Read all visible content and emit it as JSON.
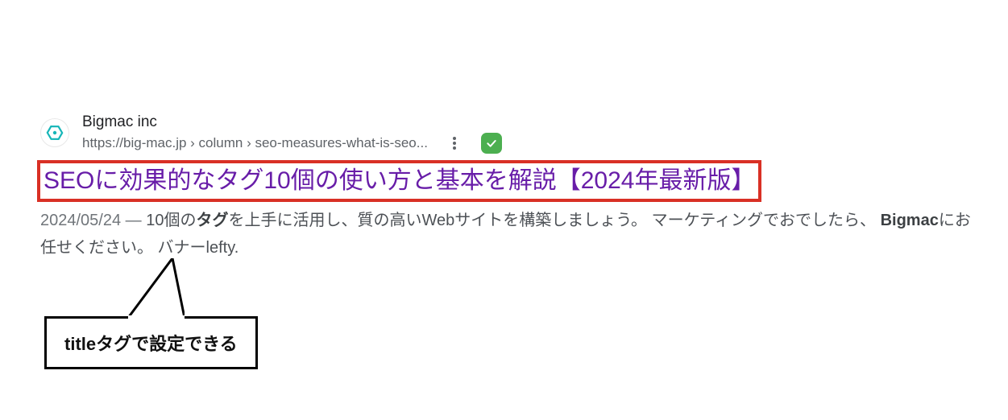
{
  "result": {
    "site_name": "Bigmac inc",
    "breadcrumbs": "https://big-mac.jp › column › seo-measures-what-is-seo...",
    "title": "SEOに効果的なタグ10個の使い方と基本を解説【2024年最新版】",
    "snippet_date": "2024/05/24",
    "snippet_sep": " — ",
    "snippet_p1": "10個の",
    "snippet_b1": "タグ",
    "snippet_p2": "を上手に活用し、質の高いWebサイトを構築しましょう。 マーケティングでお",
    "snippet_p2b": "でしたら、 ",
    "snippet_b2": "Bigmac",
    "snippet_p3": "にお任せください。 バナーlefty."
  },
  "callout": {
    "text": "titleタグで設定できる"
  },
  "icons": {
    "favicon": "bigmac-logo",
    "more": "more-vert-icon",
    "verified": "checkmark-icon"
  }
}
